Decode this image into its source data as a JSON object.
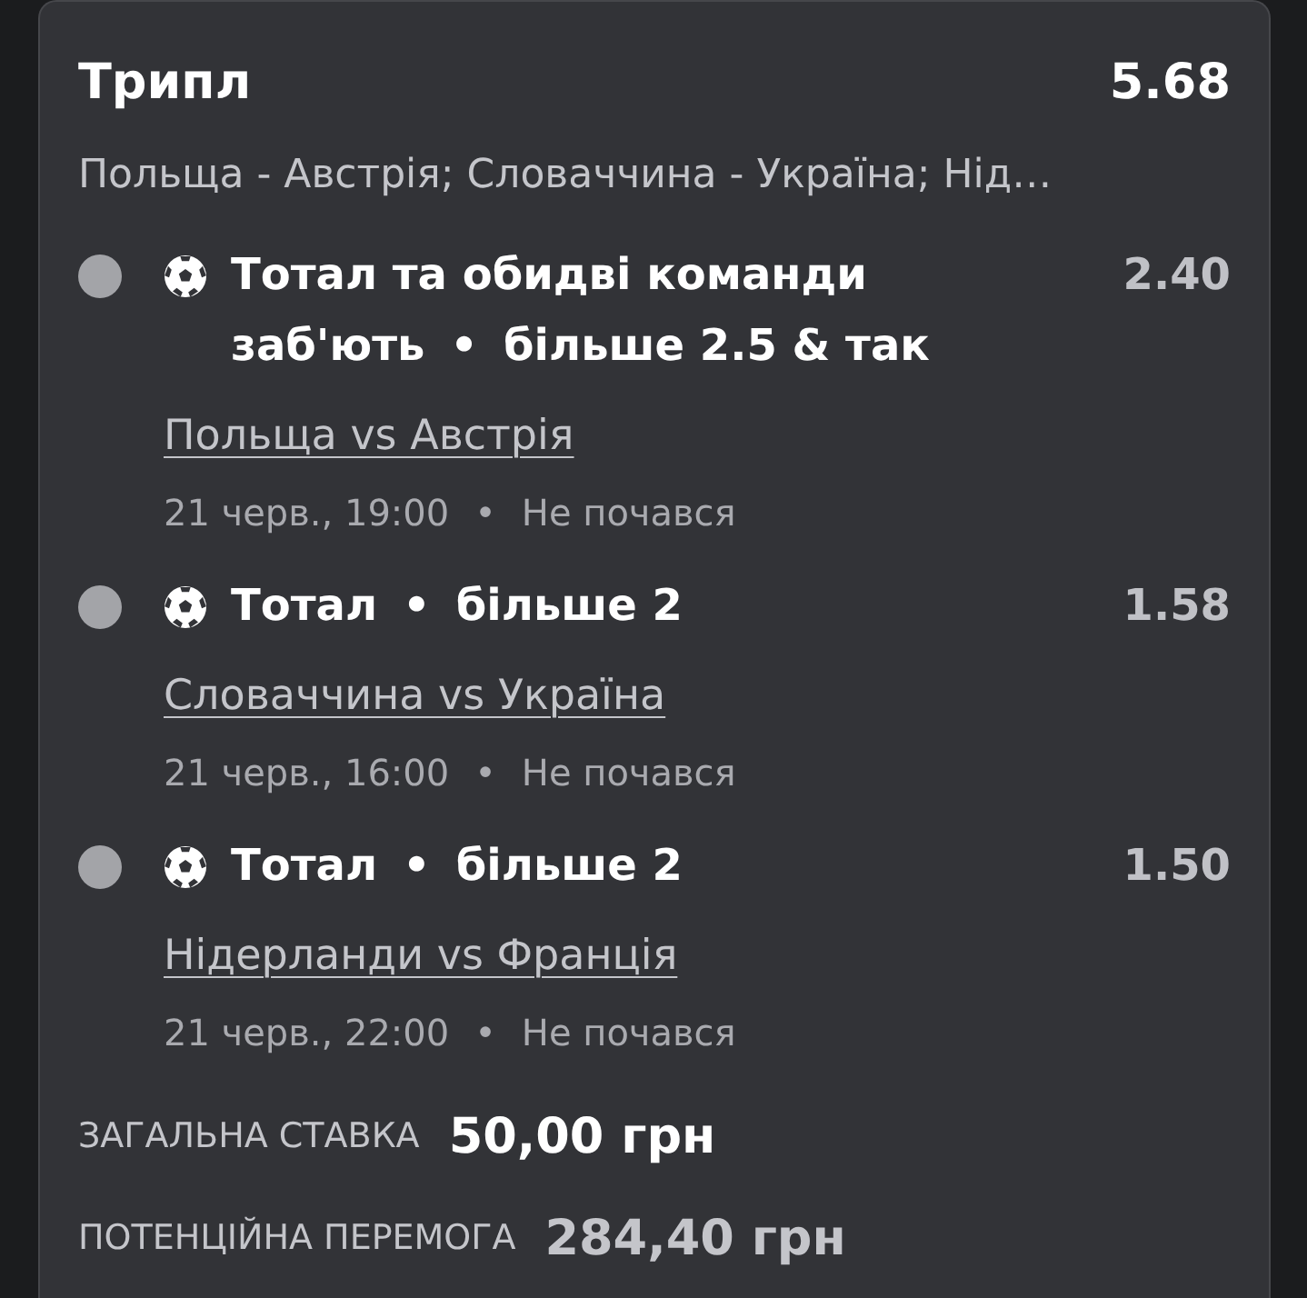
{
  "bet": {
    "type": "Трипл",
    "total_odds": "5.68",
    "summary": "Польща - Австрія; Словаччина - Україна; Нід…"
  },
  "legs": [
    {
      "color": "#a3a4a8",
      "market": "Тотал та обидві команди заб'ють",
      "market_separator": "•",
      "selection": "більше 2.5 & так",
      "odds": "2.40",
      "match": "Польща vs Австрія",
      "time": "21 черв., 19:00",
      "info_separator": "•",
      "status": "Не почався"
    },
    {
      "color": "#a3a4a8",
      "market": "Тотал",
      "market_separator": "•",
      "selection": "більше 2",
      "odds": "1.58",
      "match": "Словаччина vs Україна",
      "time": "21 черв., 16:00",
      "info_separator": "•",
      "status": "Не почався"
    },
    {
      "color": "#a3a4a8",
      "market": "Тотал",
      "market_separator": "•",
      "selection": "більше 2",
      "odds": "1.50",
      "match": "Нідерланди vs Франція",
      "time": "21 черв., 22:00",
      "info_separator": "•",
      "status": "Не почався"
    }
  ],
  "totals": [
    {
      "kind": "stake",
      "label": "ЗАГАЛЬНА СТАВКА",
      "amount": "50,00 грн"
    },
    {
      "kind": "payout",
      "label": "ПОТЕНЦІЙНА ПЕРЕМОГА",
      "amount": "284,40 грн"
    }
  ]
}
